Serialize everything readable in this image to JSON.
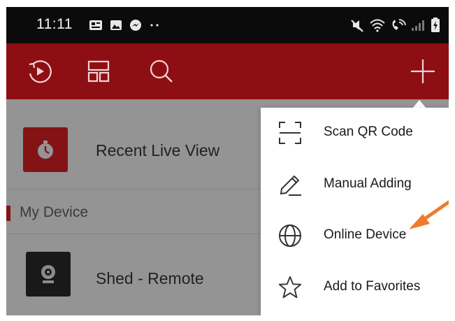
{
  "status_bar": {
    "time": "11:11",
    "left_icons": [
      "notification-card-icon",
      "gallery-icon",
      "messenger-icon",
      "more-dots-icon"
    ],
    "right_icons": [
      "mute-icon",
      "wifi-icon",
      "wifi-calling-icon",
      "signal-icon",
      "battery-charging-icon"
    ]
  },
  "toolbar": {
    "icons": [
      "playback-icon",
      "layout-icon",
      "search-icon",
      "add-icon"
    ],
    "background": "#8d0f14"
  },
  "list": {
    "recent_label": "Recent Live View",
    "section_label": "My Device",
    "device_label": "Shed - Remote"
  },
  "menu": {
    "items": [
      {
        "label": "Scan QR Code",
        "icon": "qr-scan-icon"
      },
      {
        "label": "Manual Adding",
        "icon": "pencil-icon"
      },
      {
        "label": "Online Device",
        "icon": "globe-icon"
      },
      {
        "label": "Add to Favorites",
        "icon": "star-icon"
      }
    ]
  },
  "colors": {
    "accent": "#e32126",
    "annotation_arrow": "#f07a2c"
  }
}
